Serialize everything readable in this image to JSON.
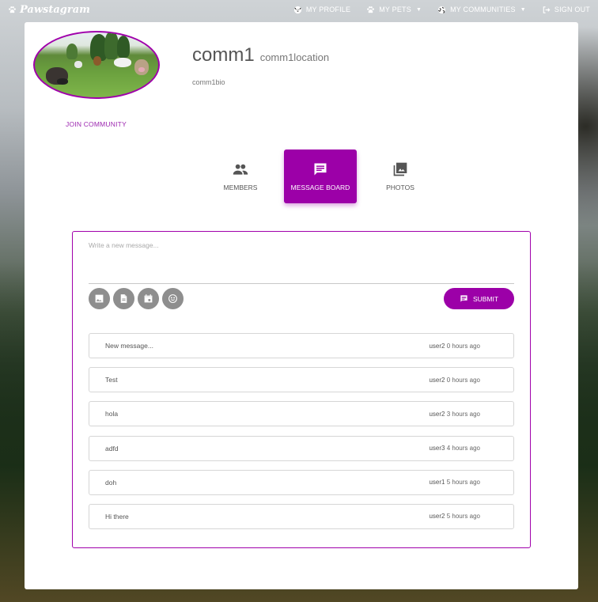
{
  "colors": {
    "accent": "#9c00a8",
    "border_accent": "#a000ab",
    "tool_gray": "#8e8e8e"
  },
  "navbar": {
    "brand": "Pawstagram",
    "brand_icon": "paw-icon",
    "items": [
      {
        "label": "MY PROFILE",
        "icon": "dog-face-icon",
        "dropdown": false
      },
      {
        "label": "MY PETS",
        "icon": "paw-icon",
        "dropdown": true
      },
      {
        "label": "MY COMMUNITIES",
        "icon": "globe-icon",
        "dropdown": true
      },
      {
        "label": "SIGN OUT",
        "icon": "sign-out-icon",
        "dropdown": false
      }
    ]
  },
  "community": {
    "name": "comm1",
    "location": "comm1location",
    "bio": "comm1bio",
    "join_label": "JOIN COMMUNITY"
  },
  "tabs": [
    {
      "label": "MEMBERS",
      "icon": "people-icon",
      "active": false
    },
    {
      "label": "MESSAGE BOARD",
      "icon": "message-icon",
      "active": true
    },
    {
      "label": "PHOTOS",
      "icon": "photos-icon",
      "active": false
    }
  ],
  "compose": {
    "placeholder": "Write a new message...",
    "value": "",
    "tools": [
      "image-icon",
      "file-icon",
      "calendar-icon",
      "emoji-icon"
    ],
    "submit_label": "SUBMIT"
  },
  "messages": [
    {
      "text": "New message...",
      "user": "user2",
      "time": "0 hours ago"
    },
    {
      "text": "Test",
      "user": "user2",
      "time": "0 hours ago"
    },
    {
      "text": "hola",
      "user": "user2",
      "time": "3 hours ago"
    },
    {
      "text": "adfd",
      "user": "user3",
      "time": "4 hours ago"
    },
    {
      "text": "doh",
      "user": "user1",
      "time": "5 hours ago"
    },
    {
      "text": "Hi there",
      "user": "user2",
      "time": "5 hours ago"
    }
  ]
}
